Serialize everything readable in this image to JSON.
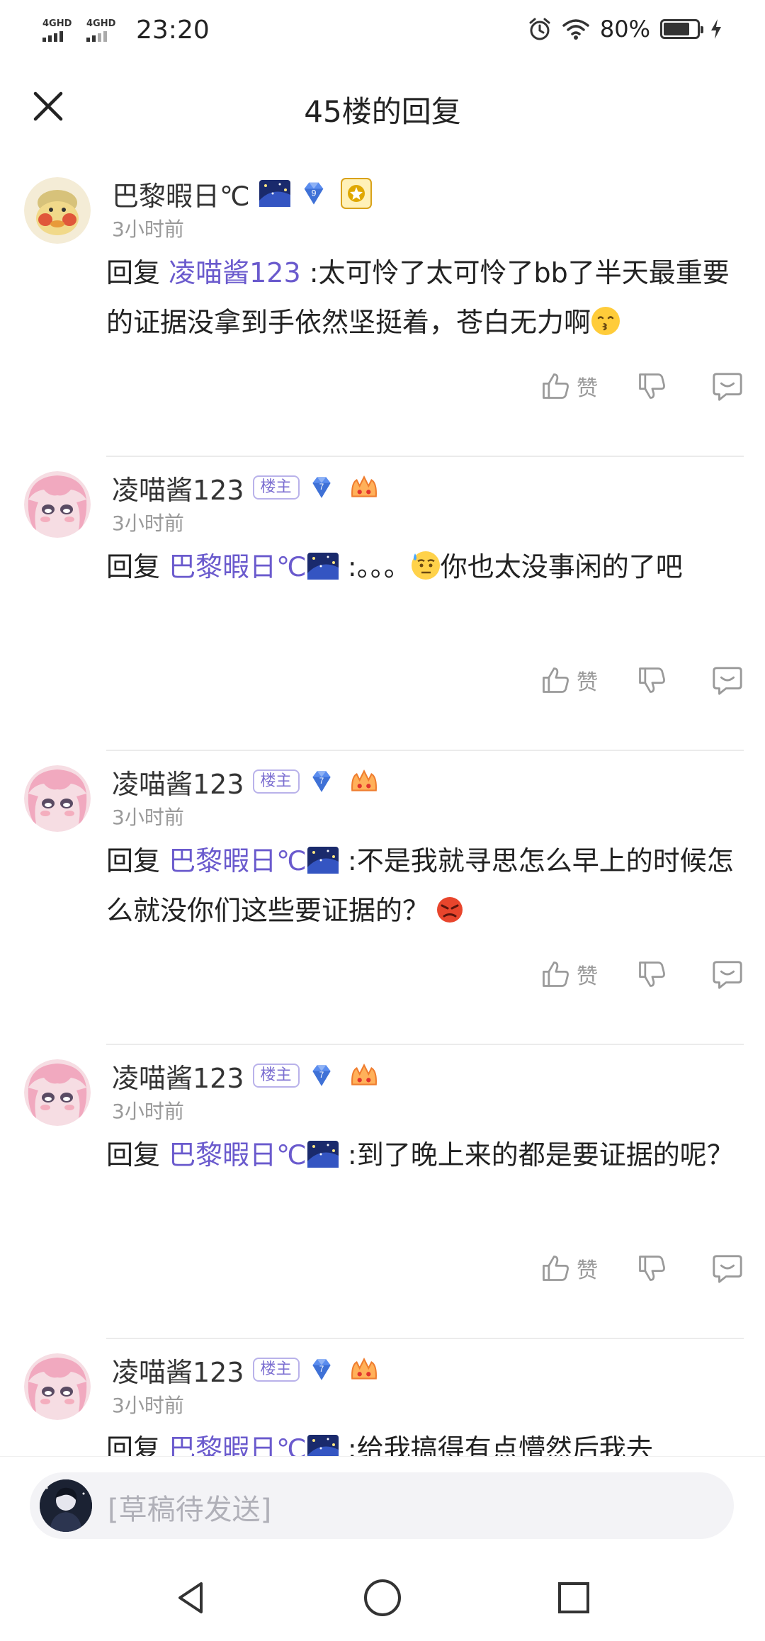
{
  "status_bar": {
    "network_1": "4GHD",
    "network_2": "4GHD",
    "time": "23:20",
    "battery_percent": "80%",
    "battery_level": 0.8
  },
  "header": {
    "title": "45楼的回复",
    "close_icon": "close-icon"
  },
  "labels": {
    "reply_prefix": "回复",
    "host_badge": "楼主",
    "like": "赞"
  },
  "comments": [
    {
      "author": "巴黎暇日℃",
      "level": "9",
      "time": "3小时前",
      "reply_to": "凌喵酱123",
      "text": ":太可怜了太可怜了bb了半天最重要的证据没拿到手依然坚挺着，苍白无力啊",
      "is_host": false
    },
    {
      "author": "凌喵酱123",
      "level": "7",
      "time": "3小时前",
      "reply_to": "巴黎暇日℃",
      "text_before": ":。。。",
      "text_after": "你也太没事闲的了吧",
      "is_host": true
    },
    {
      "author": "凌喵酱123",
      "level": "7",
      "time": "3小时前",
      "reply_to": "巴黎暇日℃",
      "text": ":不是我就寻思怎么早上的时候怎么就没你们这些要证据的？",
      "is_host": true
    },
    {
      "author": "凌喵酱123",
      "level": "7",
      "time": "3小时前",
      "reply_to": "巴黎暇日℃",
      "text": ":到了晚上来的都是要证据的呢？",
      "is_host": true
    },
    {
      "author": "凌喵酱123",
      "level": "7",
      "time": "3小时前",
      "reply_to": "巴黎暇日℃",
      "text": ":给我搞得有点懵然后我去",
      "is_host": true
    }
  ],
  "composer": {
    "placeholder": "[草稿待发送]"
  },
  "colors": {
    "mention": "#6a5acd",
    "host_badge": "#7c6fd1",
    "level_badge": "#5b8def",
    "meta_text": "#999999"
  }
}
